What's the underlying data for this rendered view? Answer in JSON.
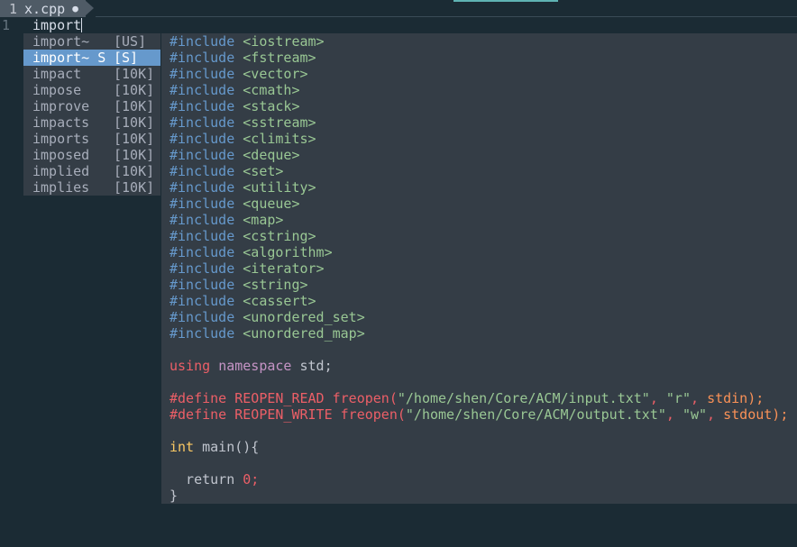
{
  "tab": {
    "number": "1",
    "filename": "x.cpp",
    "modified_icon": "●"
  },
  "editor": {
    "line_number": "1",
    "current_line": "import"
  },
  "completion": {
    "items": [
      {
        "word": "import~",
        "kind": "[US]",
        "selected": false
      },
      {
        "word": "import~ S",
        "kind": "[S]",
        "selected": true
      },
      {
        "word": "impact",
        "kind": "[10K]",
        "selected": false
      },
      {
        "word": "impose",
        "kind": "[10K]",
        "selected": false
      },
      {
        "word": "improve",
        "kind": "[10K]",
        "selected": false
      },
      {
        "word": "impacts",
        "kind": "[10K]",
        "selected": false
      },
      {
        "word": "imports",
        "kind": "[10K]",
        "selected": false
      },
      {
        "word": "imposed",
        "kind": "[10K]",
        "selected": false
      },
      {
        "word": "implied",
        "kind": "[10K]",
        "selected": false
      },
      {
        "word": "implies",
        "kind": "[10K]",
        "selected": false
      }
    ]
  },
  "preview": {
    "includes": [
      "<iostream>",
      "<fstream>",
      "<vector>",
      "<cmath>",
      "<stack>",
      "<sstream>",
      "<climits>",
      "<deque>",
      "<set>",
      "<utility>",
      "<queue>",
      "<map>",
      "<cstring>",
      "<algorithm>",
      "<iterator>",
      "<string>",
      "<cassert>",
      "<unordered_set>",
      "<unordered_map>"
    ],
    "include_kw": "#include",
    "using_kw": "using",
    "namespace_kw": "namespace",
    "namespace_rest": " std;",
    "define1": {
      "kw": "#define",
      "name": " REOPEN_READ freopen(",
      "path": "\"/home/shen/Core/ACM/input.txt\"",
      "sep1": ", ",
      "mode": "\"r\"",
      "sep2": ", ",
      "stream": "stdin);"
    },
    "define2": {
      "kw": "#define",
      "name": " REOPEN_WRITE freopen(",
      "path": "\"/home/shen/Core/ACM/output.txt\"",
      "sep1": ", ",
      "mode": "\"w\"",
      "sep2": ", ",
      "stream": "stdout);"
    },
    "int_kw": "int",
    "main_sig": " main(){",
    "return_kw": "  return ",
    "return_val": "0;",
    "close_brace": "}"
  }
}
